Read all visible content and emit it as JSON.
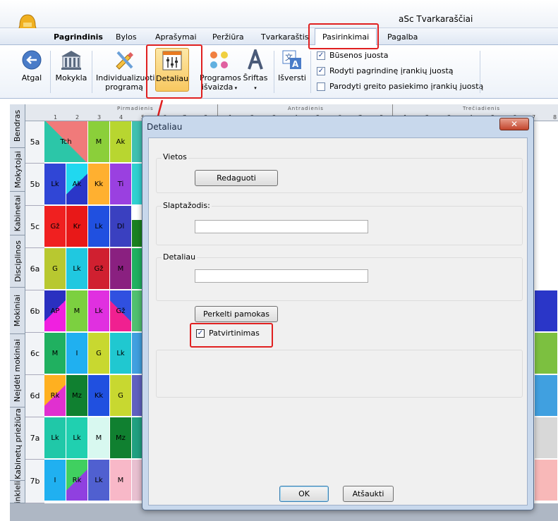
{
  "window": {
    "title": "aSc Tvarkaraščiai"
  },
  "menu": {
    "tabs": [
      "Pagrindinis",
      "Bylos",
      "Aprašymai",
      "Peržiūra",
      "Tvarkaraštis",
      "Pasirinkimai",
      "Pagalba"
    ]
  },
  "ribbon": {
    "back": "Atgal",
    "school": "Mokykla",
    "individualize_l1": "Individualizuoti",
    "individualize_l2": "programą",
    "details": "Detaliau",
    "appearance_l1": "Programos",
    "appearance_l2": "išvaizda",
    "font": "Šriftas",
    "translate": "Išversti",
    "options": [
      {
        "label": "Būsenos juosta",
        "checked": true
      },
      {
        "label": "Rodyti pagrindinę įrankių juostą",
        "checked": true
      },
      {
        "label": "Parodyti greito pasiekimo įrankių juostą",
        "checked": false
      }
    ]
  },
  "side_tabs": [
    "Bendras",
    "Mokytojai",
    "Kabinetai",
    "Disciplinos",
    "Mokiniai",
    "Neįdėti mokiniai",
    "Kabinetų priežiūra",
    "tinklelis"
  ],
  "grid": {
    "days": [
      "Pirmadienis",
      "Antradienis",
      "Trečiadienis"
    ],
    "periods": [
      "1",
      "2",
      "3",
      "4",
      "5",
      "6",
      "7",
      "8",
      "1",
      "2",
      "3",
      "4",
      "5",
      "6",
      "7",
      "8",
      "1",
      "2",
      "3",
      "4",
      "5",
      "6",
      "7",
      "8"
    ],
    "rows": [
      {
        "class": "5a",
        "cells": [
          "",
          "Tch",
          "M",
          "Ak"
        ]
      },
      {
        "class": "5b",
        "cells": [
          "Lk",
          "Ak",
          "Kk",
          "Ti"
        ]
      },
      {
        "class": "5c",
        "cells": [
          "Gž",
          "Kr",
          "Lk",
          "Dl"
        ]
      },
      {
        "class": "6a",
        "cells": [
          "G",
          "Lk",
          "Gž",
          "M"
        ]
      },
      {
        "class": "6b",
        "cells": [
          "AP",
          "M",
          "Lk",
          "Gž"
        ]
      },
      {
        "class": "6c",
        "cells": [
          "M",
          "I",
          "G",
          "Lk"
        ]
      },
      {
        "class": "6d",
        "cells": [
          "Rk",
          "Mz",
          "Kk",
          "G"
        ]
      },
      {
        "class": "7a",
        "cells": [
          "Lk",
          "Lk",
          "M",
          "Mz"
        ]
      },
      {
        "class": "7b",
        "cells": [
          "I",
          "Rk",
          "Lk",
          "M"
        ]
      }
    ]
  },
  "dialog": {
    "title": "Detaliau",
    "close": "✕",
    "group_places": "Vietos",
    "edit_button": "Redaguoti",
    "password_label": "Slaptažodis:",
    "details_label": "Detaliau",
    "move_button": "Perkelti pamokas",
    "confirm_label": "Patvirtinimas",
    "confirm_checked": true,
    "ok": "OK",
    "cancel": "Atšaukti"
  }
}
